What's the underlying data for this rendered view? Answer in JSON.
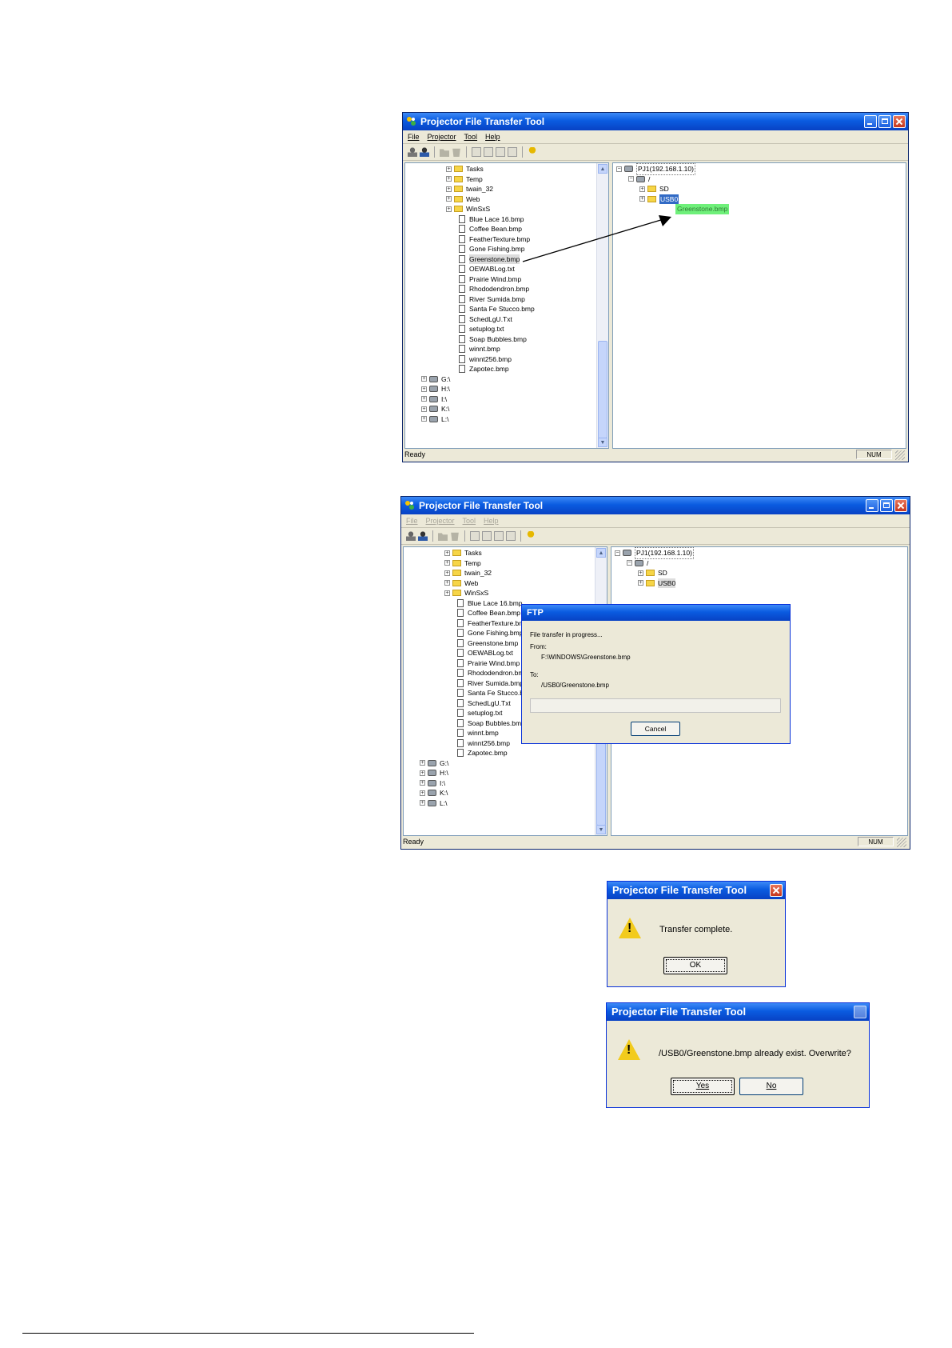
{
  "window1": {
    "title": "Projector File Transfer Tool",
    "menu": [
      "File",
      "Projector",
      "Tool",
      "Help"
    ],
    "left_folders": [
      "Tasks",
      "Temp",
      "twain_32",
      "Web",
      "WinSxS"
    ],
    "left_files": [
      "Blue Lace 16.bmp",
      "Coffee Bean.bmp",
      "FeatherTexture.bmp",
      "Gone Fishing.bmp",
      "Greenstone.bmp",
      "OEWABLog.txt",
      "Prairie Wind.bmp",
      "Rhododendron.bmp",
      "River Sumida.bmp",
      "Santa Fe Stucco.bmp",
      "SchedLgU.Txt",
      "setuplog.txt",
      "Soap Bubbles.bmp",
      "winnt.bmp",
      "winnt256.bmp",
      "Zapotec.bmp"
    ],
    "left_drives": [
      "G:\\",
      "H:\\",
      "I:\\",
      "K:\\",
      "L:\\"
    ],
    "right_root": "PJ1(192.168.1.10)",
    "right_slash": "/",
    "right_sd": "SD",
    "right_usb": "USB0",
    "drag_label": "Greenstone.bmp",
    "status": "Ready",
    "num": "NUM"
  },
  "window2": {
    "title": "Projector File Transfer Tool",
    "menu": [
      "File",
      "Projector",
      "Tool",
      "Help"
    ],
    "left_folders": [
      "Tasks",
      "Temp",
      "twain_32",
      "Web",
      "WinSxS"
    ],
    "left_files": [
      "Blue Lace 16.bmp",
      "Coffee Bean.bmp",
      "FeatherTexture.bmp",
      "Gone Fishing.bmp",
      "Greenstone.bmp",
      "OEWABLog.txt",
      "Prairie Wind.bmp",
      "Rhododendron.bmp",
      "River Sumida.bmp",
      "Santa Fe Stucco.bmp",
      "SchedLgU.Txt",
      "setuplog.txt",
      "Soap Bubbles.bmp",
      "winnt.bmp",
      "winnt256.bmp",
      "Zapotec.bmp"
    ],
    "left_drives": [
      "G:\\",
      "H:\\",
      "I:\\",
      "K:\\",
      "L:\\"
    ],
    "right_root": "PJ1(192.168.1.10)",
    "right_slash": "/",
    "right_sd": "SD",
    "right_usb": "USB0",
    "status": "Ready",
    "num": "NUM"
  },
  "ftp_dialog": {
    "title": "FTP",
    "progress_text": "File transfer in progress...",
    "from_label": "From:",
    "from_path": "F:\\WINDOWS\\Greenstone.bmp",
    "to_label": "To:",
    "to_path": "/USB0/Greenstone.bmp",
    "cancel": "Cancel"
  },
  "complete_dialog": {
    "title": "Projector File Transfer Tool",
    "message": "Transfer complete.",
    "ok": "OK"
  },
  "overwrite_dialog": {
    "title": "Projector File Transfer Tool",
    "message": "/USB0/Greenstone.bmp already exist. Overwrite?",
    "yes": "Yes",
    "no": "No"
  }
}
